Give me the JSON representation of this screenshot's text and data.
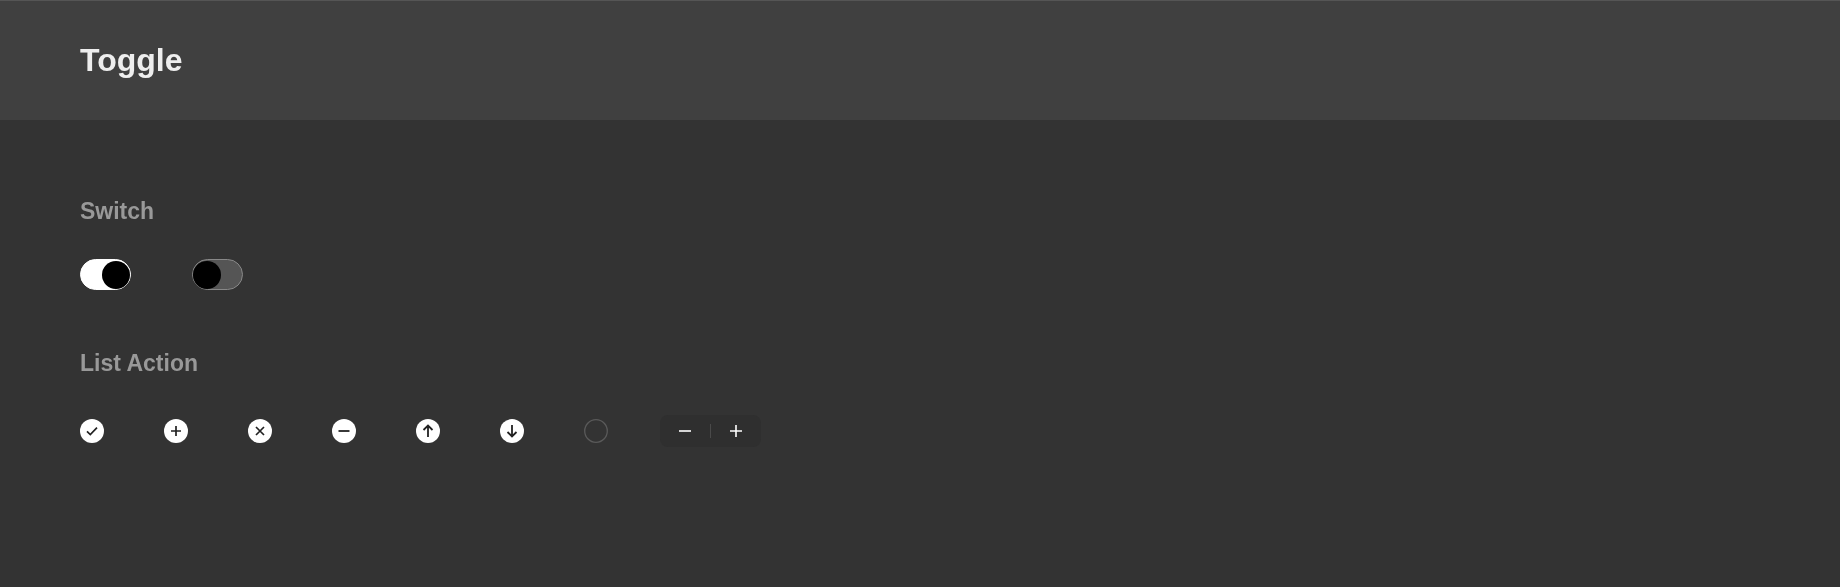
{
  "header": {
    "title": "Toggle"
  },
  "sections": [
    {
      "title": "Switch",
      "kind": "switches",
      "switches": [
        {
          "on": true
        },
        {
          "on": false
        }
      ]
    },
    {
      "title": "List Action",
      "kind": "actions",
      "actions": [
        {
          "kind": "check"
        },
        {
          "kind": "add"
        },
        {
          "kind": "remove"
        },
        {
          "kind": "minus"
        },
        {
          "kind": "up"
        },
        {
          "kind": "down"
        },
        {
          "kind": "empty"
        },
        {
          "kind": "stepper"
        }
      ]
    }
  ]
}
